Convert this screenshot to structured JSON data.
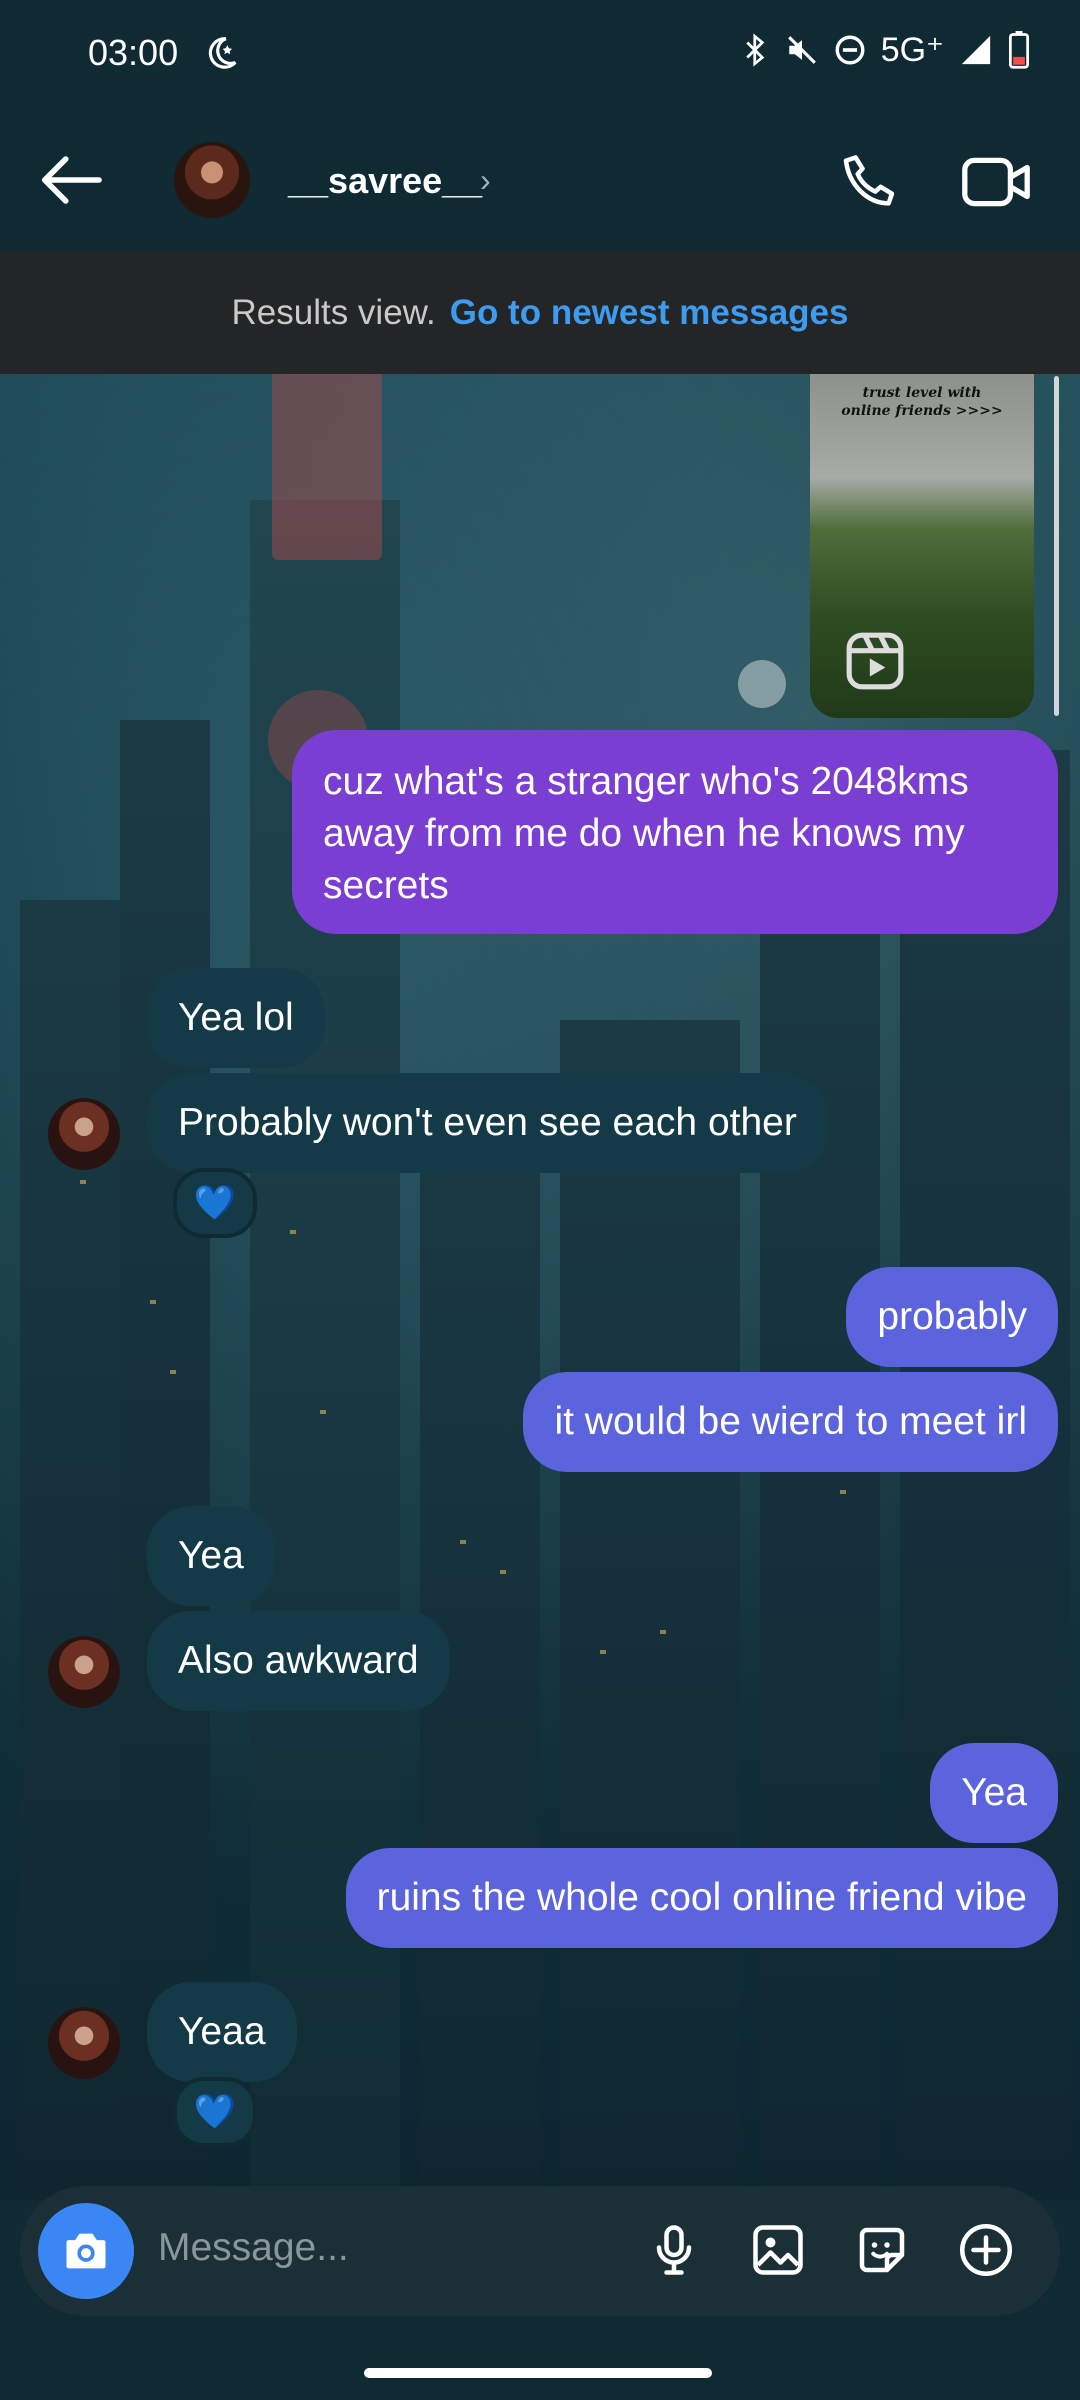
{
  "status": {
    "time": "03:00",
    "network": "5G⁺",
    "icons": [
      "moon-icon",
      "bluetooth-icon",
      "mute-icon",
      "dnd-icon",
      "signal-icon",
      "battery-icon"
    ]
  },
  "header": {
    "username": "__savree__",
    "icons": [
      "back-arrow-icon",
      "phone-icon",
      "video-icon"
    ]
  },
  "banner": {
    "label": "Results view.",
    "link": "Go to newest messages"
  },
  "reel": {
    "caption_line1": "trust level with",
    "caption_line2": "online friends >>>>"
  },
  "messages": [
    {
      "side": "out",
      "text_lines": [
        "cuz what's a stranger who's 2048kms",
        "away from me do when he knows my",
        "secrets"
      ]
    },
    {
      "side": "in",
      "text": "Yea lol"
    },
    {
      "side": "in",
      "text": "Probably won't even see each other",
      "reaction": "💙"
    },
    {
      "side": "out",
      "text": "probably"
    },
    {
      "side": "out",
      "text": "it would be wierd to meet irl"
    },
    {
      "side": "in",
      "text": "Yea"
    },
    {
      "side": "in",
      "text": "Also awkward"
    },
    {
      "side": "out",
      "text": "Yea"
    },
    {
      "side": "out",
      "text": "ruins the whole cool online friend vibe"
    },
    {
      "side": "in",
      "text": "Yeaa",
      "reaction": "💙"
    }
  ],
  "composer": {
    "placeholder": "Message...",
    "icons": [
      "camera-icon",
      "microphone-icon",
      "gallery-icon",
      "sticker-icon",
      "add-icon"
    ]
  },
  "colors": {
    "incoming_bubble": "#143a47",
    "outgoing_bubble": "#5b63dd",
    "outgoing_bubble_top": "#7a3fd2",
    "link": "#3d9bf0",
    "camera_button": "#3a86f4"
  }
}
